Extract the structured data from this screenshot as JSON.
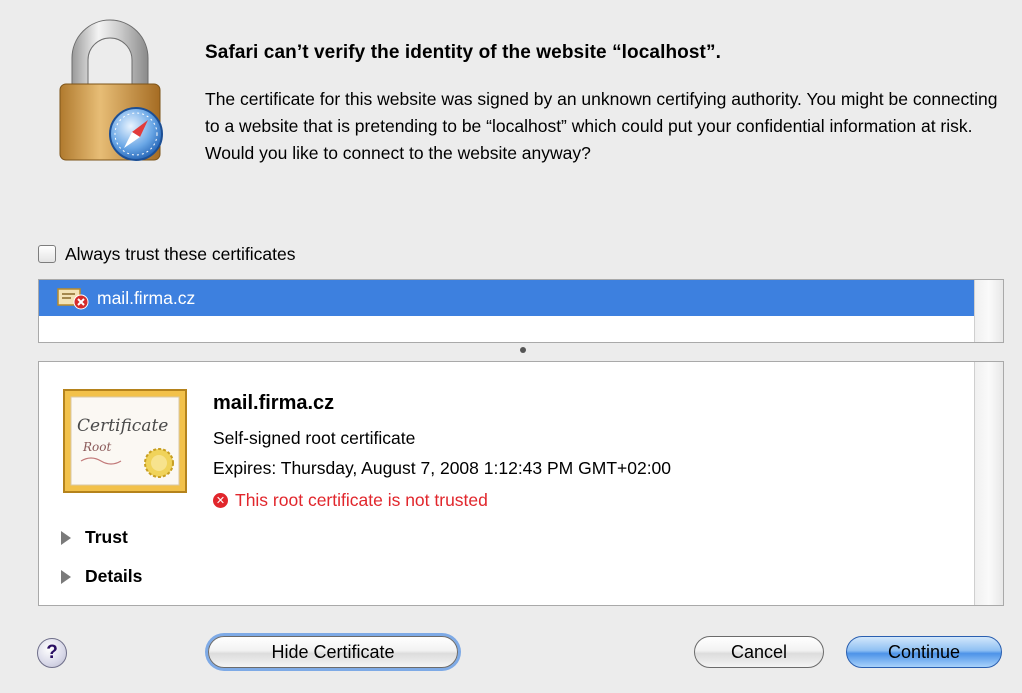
{
  "dialog": {
    "title": "Safari can’t verify the identity of the website “localhost”.",
    "message": "The certificate for this website was signed by an unknown certifying authority. You might be connecting to a website that is pretending to be “localhost” which could put your confidential information at risk. Would you like to connect to the website anyway?",
    "icon": "lock-with-safari-compass-icon"
  },
  "trust_checkbox": {
    "label": "Always trust these certificates",
    "checked": false
  },
  "certificate_list": {
    "items": [
      {
        "label": "mail.firma.cz",
        "selected": true,
        "icon": "certificate-error-icon"
      }
    ]
  },
  "details": {
    "name": "mail.firma.cz",
    "type": "Self-signed root certificate",
    "expires": "Expires: Thursday, August 7, 2008 1:12:43 PM GMT+02:00",
    "warning": "This root certificate is not trusted",
    "warning_color": "#e1262c",
    "image_text_line1": "Certificate",
    "image_text_line2": "Root",
    "sections": [
      "Trust",
      "Details"
    ]
  },
  "buttons": {
    "help": "?",
    "hide_certificate": "Hide Certificate",
    "cancel": "Cancel",
    "continue": "Continue"
  },
  "colors": {
    "selection": "#3d80df",
    "default_button": "#4d93e8",
    "dialog_background": "#ececec"
  }
}
